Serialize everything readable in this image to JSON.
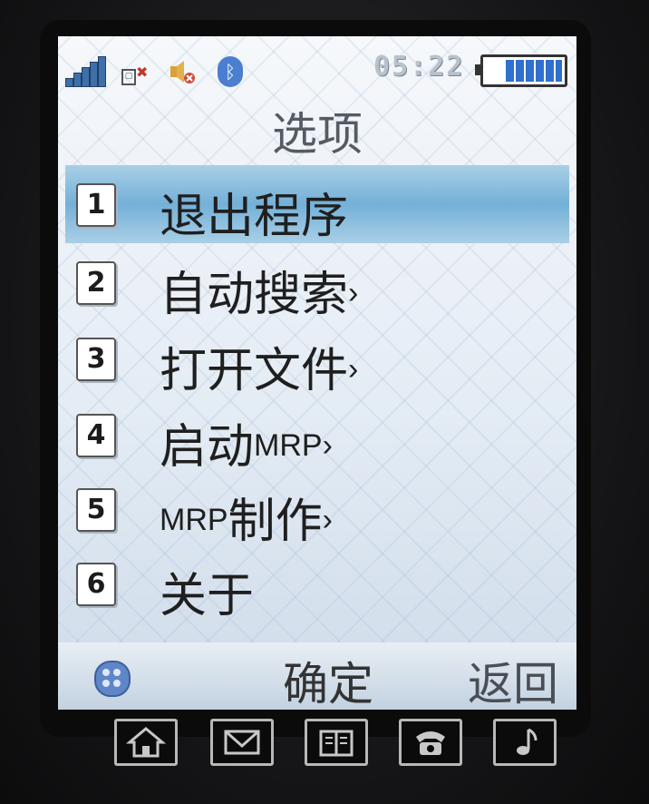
{
  "status_bar": {
    "time": "05:22",
    "battery_level": 0.8,
    "signal_icon": "signal-bars-icon",
    "bluetooth_icon": "bluetooth-icon",
    "mute_icon": "speaker-muted-icon"
  },
  "title": "选项",
  "menu": {
    "items": [
      {
        "number": "1",
        "label": "退出程序",
        "selected": true
      },
      {
        "number": "2",
        "label": "自动搜索",
        "arrow": "›"
      },
      {
        "number": "3",
        "label": "打开文件",
        "arrow": "›"
      },
      {
        "number": "4",
        "label_cn": "启动",
        "label_latin": "MRP",
        "arrow": "›"
      },
      {
        "number": "5",
        "label_latin": "MRP",
        "label_cn": "制作",
        "arrow": "›"
      },
      {
        "number": "6",
        "label": "关于"
      }
    ]
  },
  "softkeys": {
    "left": "确定",
    "right": "返回"
  },
  "hardware_keys": [
    "home-icon",
    "mail-icon",
    "book-icon",
    "phone-icon",
    "music-icon"
  ],
  "colors": {
    "highlight": "#74b0d8",
    "battery": "#2f6fd0"
  }
}
